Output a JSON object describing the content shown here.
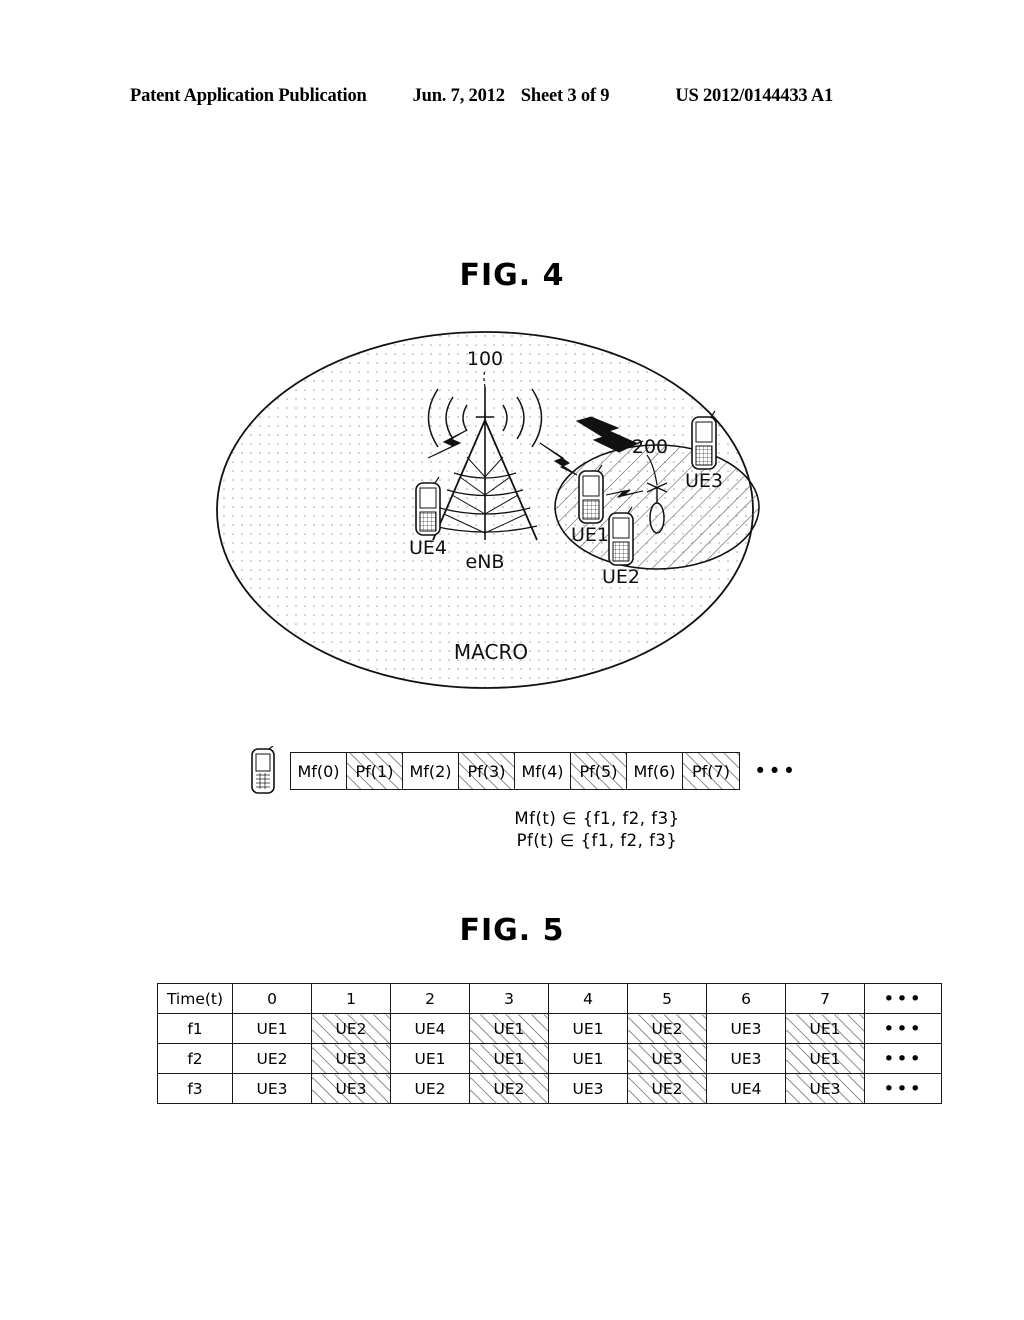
{
  "header": {
    "publication": "Patent Application Publication",
    "date": "Jun. 7, 2012",
    "sheet": "Sheet 3 of 9",
    "number": "US 2012/0144433 A1"
  },
  "fig4": {
    "title": "FIG. 4",
    "macro_label": "MACRO",
    "enb_label": "eNB",
    "enb_ref": "100",
    "small_cell_ref": "200",
    "ue_labels": {
      "ue1": "UE1",
      "ue2": "UE2",
      "ue3": "UE3",
      "ue4": "UE4"
    },
    "frame_sequence": [
      {
        "label": "Mf(0)",
        "hatched": false
      },
      {
        "label": "Pf(1)",
        "hatched": true
      },
      {
        "label": "Mf(2)",
        "hatched": false
      },
      {
        "label": "Pf(3)",
        "hatched": true
      },
      {
        "label": "Mf(4)",
        "hatched": false
      },
      {
        "label": "Pf(5)",
        "hatched": true
      },
      {
        "label": "Mf(6)",
        "hatched": false
      },
      {
        "label": "Pf(7)",
        "hatched": true
      }
    ],
    "frame_ellipsis": "•••",
    "set_notation_line1": "Mf(t) ∈ {f1, f2, f3}",
    "set_notation_line2": "Pf(t) ∈ {f1, f2, f3}"
  },
  "fig5": {
    "title": "FIG. 5",
    "table": {
      "corner_header": "Time(t)",
      "columns": [
        "0",
        "1",
        "2",
        "3",
        "4",
        "5",
        "6",
        "7"
      ],
      "ellipsis": "•••",
      "rows": [
        {
          "label": "f1",
          "cells": [
            {
              "v": "UE1",
              "hatched": false
            },
            {
              "v": "UE2",
              "hatched": true
            },
            {
              "v": "UE4",
              "hatched": false
            },
            {
              "v": "UE1",
              "hatched": true
            },
            {
              "v": "UE1",
              "hatched": false
            },
            {
              "v": "UE2",
              "hatched": true
            },
            {
              "v": "UE3",
              "hatched": false
            },
            {
              "v": "UE1",
              "hatched": true
            }
          ]
        },
        {
          "label": "f2",
          "cells": [
            {
              "v": "UE2",
              "hatched": false
            },
            {
              "v": "UE3",
              "hatched": true
            },
            {
              "v": "UE1",
              "hatched": false
            },
            {
              "v": "UE1",
              "hatched": true
            },
            {
              "v": "UE1",
              "hatched": false
            },
            {
              "v": "UE3",
              "hatched": true
            },
            {
              "v": "UE3",
              "hatched": false
            },
            {
              "v": "UE1",
              "hatched": true
            }
          ]
        },
        {
          "label": "f3",
          "cells": [
            {
              "v": "UE3",
              "hatched": false
            },
            {
              "v": "UE3",
              "hatched": true
            },
            {
              "v": "UE2",
              "hatched": false
            },
            {
              "v": "UE2",
              "hatched": true
            },
            {
              "v": "UE3",
              "hatched": false
            },
            {
              "v": "UE2",
              "hatched": true
            },
            {
              "v": "UE4",
              "hatched": false
            },
            {
              "v": "UE3",
              "hatched": true
            }
          ]
        }
      ]
    }
  },
  "colors": {
    "ink": "#000000",
    "line": "#1a1a1a",
    "paper": "#ffffff"
  }
}
